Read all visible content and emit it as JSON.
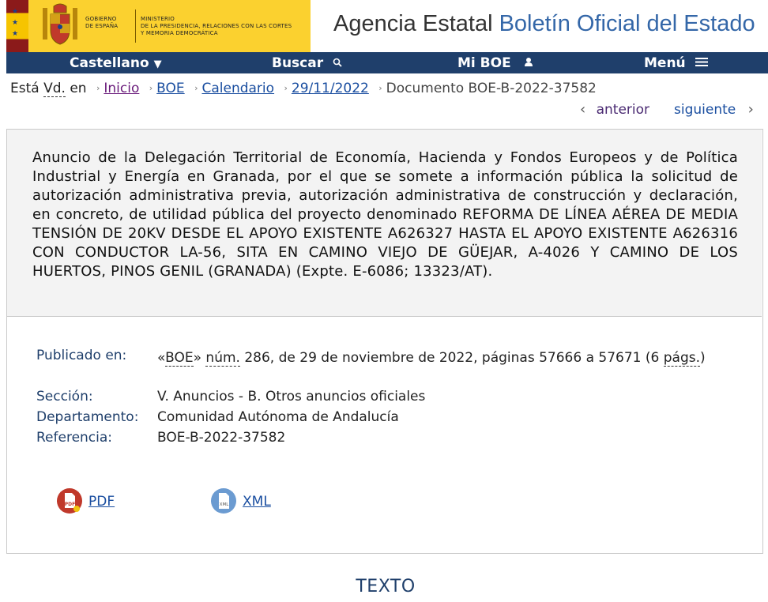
{
  "header": {
    "gov_line1": "GOBIERNO",
    "gov_line2": "DE ESPAÑA",
    "ministry_line1": "MINISTERIO",
    "ministry_line2": "DE LA PRESIDENCIA, RELACIONES CON LAS CORTES",
    "ministry_line3": "Y MEMORIA DEMOCRÁTICA",
    "title_part1": "Agencia Estatal",
    "title_part2": "Boletín Oficial del Estado"
  },
  "nav": {
    "language": "Castellano",
    "search": "Buscar",
    "my_boe": "Mi BOE",
    "menu": "Menú"
  },
  "breadcrumb": {
    "prefix": "Está",
    "abbr": "Vd.",
    "suffix": "en",
    "items": [
      "Inicio",
      "BOE",
      "Calendario",
      "29/11/2022"
    ],
    "current": "Documento BOE-B-2022-37582"
  },
  "pager": {
    "previous": "anterior",
    "next": "siguiente"
  },
  "document": {
    "title": "Anuncio de la Delegación Territorial de Economía, Hacienda y Fondos Europeos y de Política Industrial y Energía en Granada, por el que se somete a información pública la solicitud de autorización administrativa previa, autorización administrativa de construcción y declaración, en concreto, de utilidad pública del proyecto denominado REFORMA DE LÍNEA AÉREA DE MEDIA TENSIÓN DE 20KV DESDE EL APOYO EXISTENTE A626327 HASTA EL APOYO EXISTENTE A626316 CON CONDUCTOR LA-56, SITA EN CAMINO VIEJO DE GÜEJAR, A-4026 Y CAMINO DE LOS HUERTOS, PINOS GENIL (GRANADA) (Expte. E-6086; 13323/AT).",
    "published_label": "Publicado en:",
    "published_open": "«",
    "published_boe": "BOE",
    "published_close": "»",
    "published_num_abbr": "núm.",
    "published_rest": " 286, de 29 de noviembre de 2022, páginas 57666 a 57671 (6 ",
    "published_pags_abbr": "págs.",
    "published_end": ")",
    "section_label": "Sección:",
    "section_value": "V. Anuncios - B. Otros anuncios oficiales",
    "department_label": "Departamento:",
    "department_value": "Comunidad Autónoma de Andalucía",
    "reference_label": "Referencia:",
    "reference_value": "BOE-B-2022-37582"
  },
  "downloads": {
    "pdf_label": "PDF",
    "xml_label": "XML",
    "pdf_icon_text": "PDF",
    "xml_icon_text": "XML"
  },
  "section_heading": "TEXTO",
  "colors": {
    "nav_bg": "#1f3f6b",
    "link": "#1a4ea0",
    "visited": "#6a1b7b",
    "gov_yellow": "#fbd12f",
    "pdf_red": "#c0392b",
    "xml_blue": "#6b9bd1"
  }
}
